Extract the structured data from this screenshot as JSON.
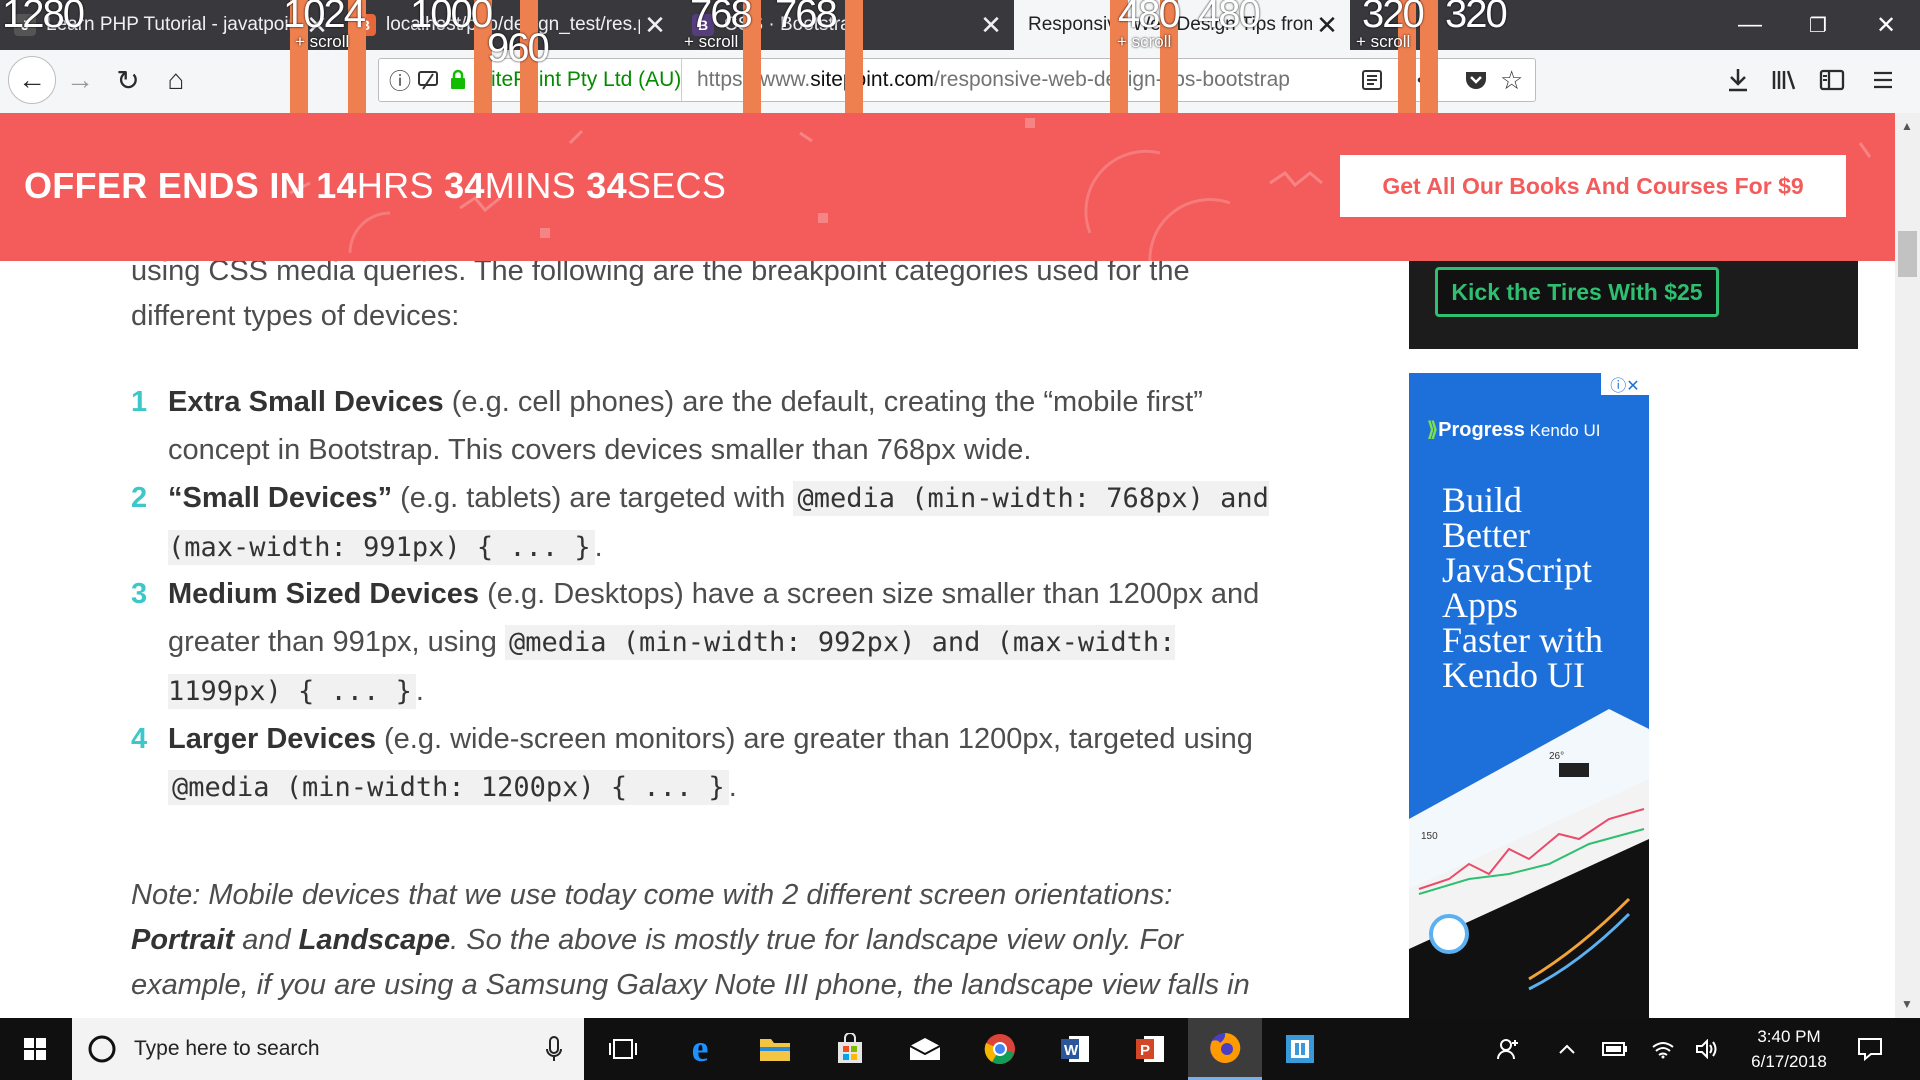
{
  "browser": {
    "tabs": [
      {
        "title": "Learn PHP Tutorial - javatpoint",
        "close": "✕"
      },
      {
        "title": "localhost/php/design_test/res.p",
        "close": "✕"
      },
      {
        "title": "CSS · Bootstrap",
        "close": "✕"
      },
      {
        "title": "Responsive Web Design Tips from B",
        "close": "✕"
      }
    ],
    "ruler": {
      "numbers": [
        "1280",
        "1024",
        "1000",
        "960",
        "768",
        "768",
        "480",
        "480",
        "320",
        "320"
      ],
      "scroll_label": "+ scroll"
    },
    "window_controls": {
      "minimize": "—",
      "maximize": "❐",
      "close": "✕"
    },
    "nav": {
      "back": "←",
      "forward": "→",
      "reload": "↻",
      "home": "⌂"
    },
    "url": {
      "site_identity": "SitePoint Pty Ltd (AU)",
      "prefix": "https://www.",
      "domain": "sitepoint.com",
      "path": "/responsive-web-design-tips-bootstrap",
      "more": "•••"
    }
  },
  "offer": {
    "prefix": "OFFER ENDS IN ",
    "hours": "14",
    "hours_unit": "HRS ",
    "mins": "34",
    "mins_unit": "MINS ",
    "secs": "34",
    "secs_unit": "SECS",
    "cta": "Get All Our Books And Courses For $9"
  },
  "article": {
    "intro": "using CSS media queries. The following are the breakpoint categories used for the different types of devices:",
    "items": [
      {
        "num": "1",
        "title": "Extra Small Devices",
        "text": " (e.g. cell phones) are the default, creating the “mobile first” concept in Bootstrap. This covers devices smaller than 768px wide."
      },
      {
        "num": "2",
        "title": "“Small Devices”",
        "text": " (e.g. tablets) are targeted with ",
        "code": "@media (min-width: 768px) and (max-width: 991px) { ... }",
        "after": "."
      },
      {
        "num": "3",
        "title": "Medium Sized Devices",
        "text": " (e.g. Desktops) have a screen size smaller than 1200px and greater than 991px, using ",
        "code": "@media (min-width: 992px) and (max-width: 1199px) { ... }",
        "after": "."
      },
      {
        "num": "4",
        "title": "Larger Devices",
        "text": " (e.g. wide-screen monitors) are greater than 1200px, targeted using ",
        "code": "@media (min-width: 1200px) { ... }",
        "after": "."
      }
    ],
    "note": {
      "lead": "Note: Mobile devices that we use today come with 2 different screen orientations: ",
      "portrait": "Portrait",
      "and": " and ",
      "landscape": "Landscape",
      "rest": ". So the above is mostly true for landscape view only. For example, if you are using a Samsung Galaxy Note III phone, the landscape view falls in the “Small Devices” category, whereas the portrait view would fall under “Extra Small"
    }
  },
  "sidebar": {
    "ad1_cta": "Kick the Tires With $25",
    "ad2": {
      "brand": "Progress",
      "product": " Kendo UI",
      "headline": [
        "Build",
        "Better",
        "JavaScript",
        "Apps",
        "Faster with",
        "Kendo UI"
      ],
      "chart_label_1": "26°",
      "chart_label_2": "150"
    }
  },
  "taskbar": {
    "search_placeholder": "Type here to search",
    "time": "3:40 PM",
    "date": "6/17/2018"
  }
}
